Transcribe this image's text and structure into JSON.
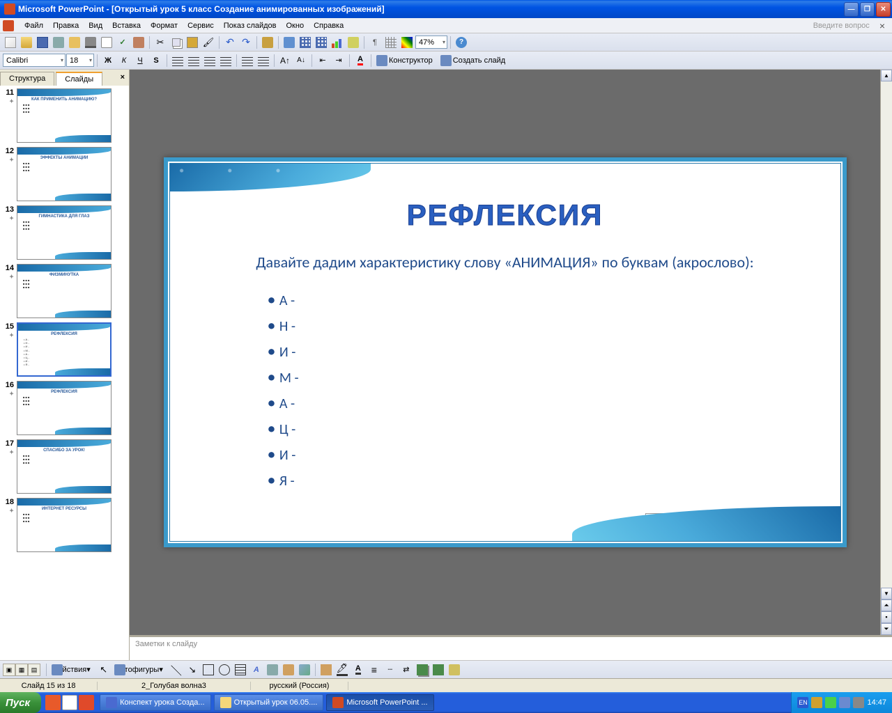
{
  "title": "Microsoft PowerPoint - [Открытый урок 5 класс Создание анимированных изображений]",
  "menu": {
    "file": "Файл",
    "edit": "Правка",
    "view": "Вид",
    "insert": "Вставка",
    "format": "Формат",
    "service": "Сервис",
    "slideshow": "Показ слайдов",
    "window": "Окно",
    "help": "Справка",
    "question": "Введите вопрос"
  },
  "toolbar1": {
    "zoom": "47%"
  },
  "toolbar2": {
    "font": "Calibri",
    "size": "18",
    "bold": "Ж",
    "italic": "К",
    "underline": "Ч",
    "shadow": "S",
    "constructor": "Конструктор",
    "newslide": "Создать слайд"
  },
  "tabs": {
    "outline": "Структура",
    "slides": "Слайды"
  },
  "thumbnails": [
    {
      "n": "11",
      "title": "КАК ПРИМЕНИТЬ АНИМАЦИЮ?"
    },
    {
      "n": "12",
      "title": "ЭФФЕКТЫ АНИМАЦИИ"
    },
    {
      "n": "13",
      "title": "ГИМНАСТИКА ДЛЯ ГЛАЗ"
    },
    {
      "n": "14",
      "title": "ФИЗМИНУТКА"
    },
    {
      "n": "15",
      "title": "РЕФЛЕКСИЯ",
      "selected": true
    },
    {
      "n": "16",
      "title": "РЕФЛЕКСИЯ"
    },
    {
      "n": "17",
      "title": "СПАСИБО ЗА УРОК!"
    },
    {
      "n": "18",
      "title": "ИНТЕРНЕТ РЕСУРСЫ"
    }
  ],
  "slide": {
    "title": "РЕФЛЕКСИЯ",
    "subtitle": "Давайте дадим характеристику слову «АНИМАЦИЯ» по буквам (акрослово):",
    "items": [
      "А  -",
      "Н  -",
      "И  -",
      "М -",
      "А  -",
      "Ц  -",
      "И  -",
      "Я  -"
    ]
  },
  "notes": "Заметки к слайду",
  "drawbar": {
    "actions": "Действия",
    "autoshapes": "Автофигуры"
  },
  "status": {
    "slide": "Слайд 15 из 18",
    "theme": "2_Голубая волна3",
    "lang": "русский (Россия)"
  },
  "taskbar": {
    "start": "Пуск",
    "items": [
      {
        "label": "Конспект урока Созда...",
        "color": "#4a6ad0"
      },
      {
        "label": "Открытый урок 06.05....",
        "color": "#f5d77a"
      },
      {
        "label": "Microsoft PowerPoint ...",
        "color": "#d04a23",
        "active": true
      }
    ],
    "lang": "EN",
    "time": "14:47"
  }
}
